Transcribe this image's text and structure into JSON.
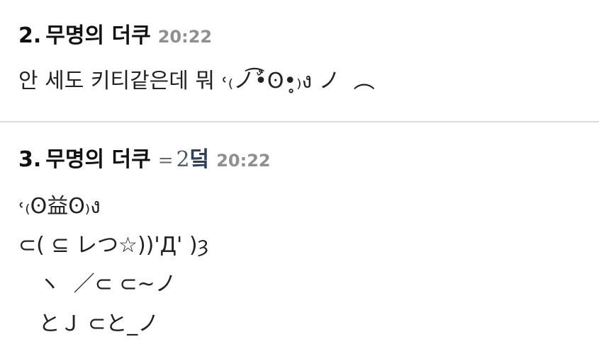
{
  "comments": [
    {
      "number": "2.",
      "author": "무명의 더쿠",
      "time": "20:22",
      "lines": [
        "안 세도 키티같은데 뭐 ˓₍ノ•ٌ͡ʘ•̥₎ง ノ  ︵"
      ]
    },
    {
      "number": "3.",
      "author": "무명의 더쿠",
      "reply_arrow": "=",
      "reply_ref_number": "2",
      "reply_ref_suffix": "덬",
      "time": "20:22",
      "lines": [
        "˓₍ʘ益ʘ₎ง",
        "⊂( ⊆ レつ☆))'Д' )ȝ",
        "   ヽ  ／⊂ ⊂~ノ",
        "   とＪ ⊂と_ノ"
      ]
    }
  ]
}
